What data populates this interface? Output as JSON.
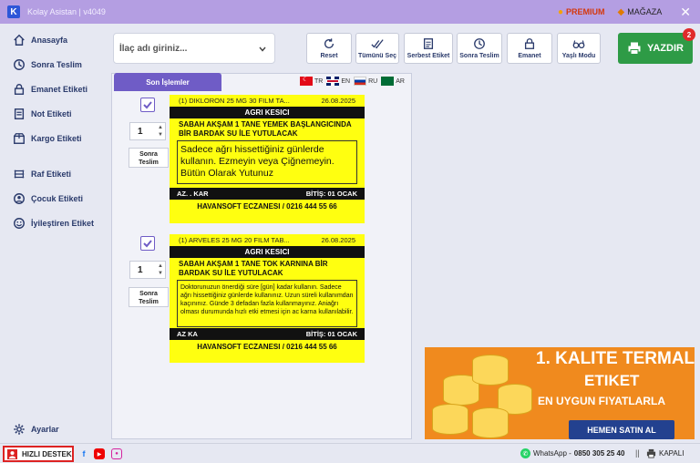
{
  "app": {
    "logo": "K",
    "title": "Kolay Asistan | v4049",
    "premium": "PREMIUM",
    "store": "MAĞAZA",
    "close": "✕"
  },
  "sidebar": {
    "items": [
      {
        "label": "Anasayfa",
        "icon": "home-icon"
      },
      {
        "label": "Sonra Teslim",
        "icon": "clock-icon"
      },
      {
        "label": "Emanet Etiketi",
        "icon": "lock-icon"
      },
      {
        "label": "Not Etiketi",
        "icon": "note-icon"
      },
      {
        "label": "Kargo Etiketi",
        "icon": "cargo-icon"
      },
      {
        "label": "Raf Etiketi",
        "icon": "shelf-icon"
      },
      {
        "label": "Çocuk Etiketi",
        "icon": "child-icon"
      },
      {
        "label": "İyileştiren Etiket",
        "icon": "smile-icon"
      }
    ],
    "settings": "Ayarlar"
  },
  "toolbar": {
    "drug_placeholder": "İlaç adı giriniz...",
    "buttons": [
      {
        "label": "Reset",
        "icon": "refresh-icon"
      },
      {
        "label": "Tümünü Seç",
        "icon": "check-all-icon"
      },
      {
        "label": "Serbest Etiket",
        "icon": "document-icon"
      },
      {
        "label": "Sonra Teslim",
        "icon": "clock-icon"
      },
      {
        "label": "Emanet",
        "icon": "lock-icon"
      },
      {
        "label": "Yaşlı Modu",
        "icon": "glasses-icon"
      }
    ],
    "print_label": "YAZDIR",
    "print_badge": "2"
  },
  "panel": {
    "tab_label": "Son İşlemler",
    "languages": [
      "TR",
      "EN",
      "RU",
      "AR"
    ]
  },
  "labels": [
    {
      "quantity": "1",
      "sonra_line1": "Sonra",
      "sonra_line2": "Teslim",
      "drug": "(1) DIKLORON 25 MG 30 FILM TA...",
      "date": "26.08.2025",
      "category": "AGRI KESICI",
      "usage": "SABAH AKŞAM 1 TANE YEMEK BAŞLANGICINDA BİR BARDAK SU İLE YUTULACAK",
      "note": "Sadece ağrı hissettiğiniz günlerde kullanın. Ezmeyin veya Çiğnemeyin. Bütün Olarak Yutunuz",
      "foot_left": "AZ. . KAR",
      "foot_right": "BİTİŞ: 01 OCAK",
      "pharmacy": "HAVANSOFT ECZANESI / 0216 444 55 66"
    },
    {
      "quantity": "1",
      "sonra_line1": "Sonra",
      "sonra_line2": "Teslim",
      "drug": "(1) ARVELES 25 MG 20 FILM TAB...",
      "date": "26.08.2025",
      "category": "AGRI KESICI",
      "usage": "SABAH AKŞAM 1 TANE TOK KARNINA BİR BARDAK SU İLE YUTULACAK",
      "note": "Doktorunuzun önerdiği süre [gün] kadar kullanın. Sadece ağrı hissettiğiniz günlerde kullanınız. Uzun süreli kullanımdan kaçınınız. Günde 3 defadan fazla kullanmayınız. Aniağrı olması durumunda hızlı etki etmesi için ac karna kullanılabilir.",
      "foot_left": "AZ KA",
      "foot_right": "BİTİŞ: 01 OCAK",
      "pharmacy": "HAVANSOFT ECZANESI / 0216 444 55 66"
    }
  ],
  "ad": {
    "line1": "1. KALITE TERMAL",
    "line2": "ETIKET",
    "line3": "EN UYGUN FIYATLARLA",
    "button": "HEMEN SATIN AL"
  },
  "bottom": {
    "support": "HIZLI DESTEK",
    "whatsapp_label": "WhatsApp -",
    "whatsapp_number": "0850 305 25 40",
    "separator": "||",
    "printer_status": "KAPALI"
  },
  "colors": {
    "accent": "#6f5cc6",
    "titlebar": "#b49ee2",
    "print": "#2e9b46",
    "label": "#ffff10"
  }
}
